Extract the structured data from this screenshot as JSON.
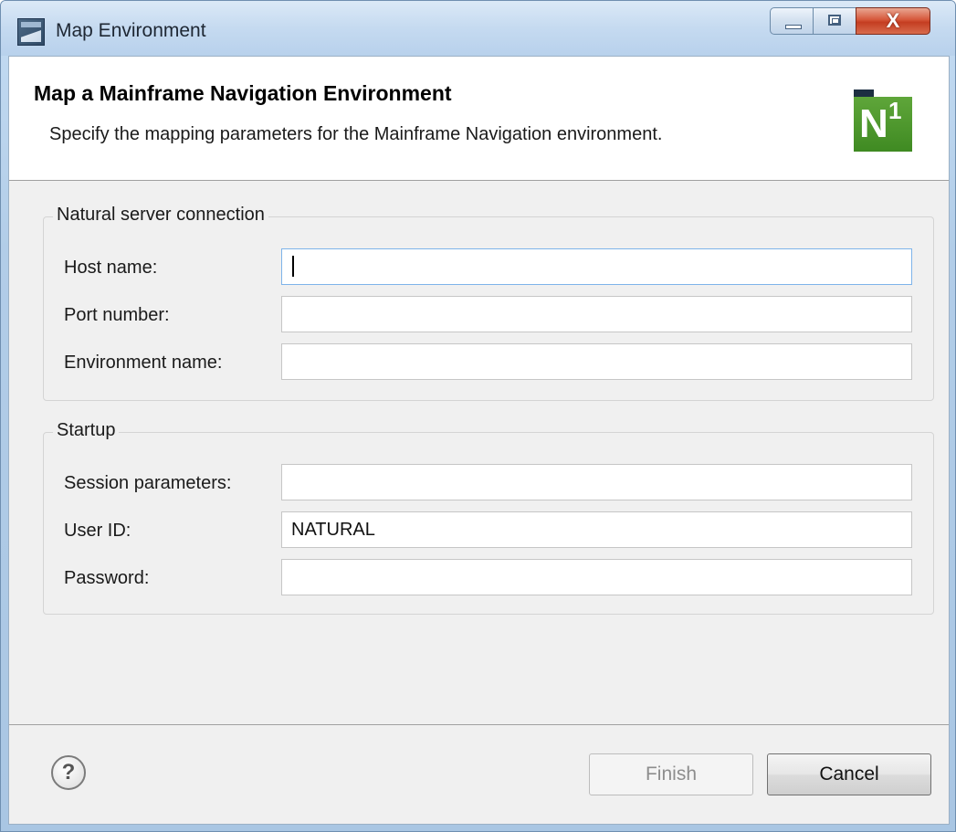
{
  "window": {
    "title": "Map Environment",
    "icons": {
      "app": "app-window-icon",
      "minimize": "minimize-icon",
      "maximize": "maximize-icon",
      "close": "close-icon"
    },
    "close_glyph": "X"
  },
  "header": {
    "title": "Map a Mainframe Navigation Environment",
    "description": "Specify the mapping parameters for the Mainframe Navigation environment.",
    "logo": {
      "letter": "N",
      "superscript": "1",
      "icon": "natural-one-logo-icon"
    }
  },
  "connection": {
    "title": "Natural server connection",
    "fields": [
      {
        "label": "Host name:",
        "value": "",
        "focused": true
      },
      {
        "label": "Port number:",
        "value": ""
      },
      {
        "label": "Environment name:",
        "value": ""
      }
    ]
  },
  "startup": {
    "title": "Startup",
    "fields": [
      {
        "label": "Session parameters:",
        "value": ""
      },
      {
        "label": "User ID:",
        "value": "NATURAL"
      },
      {
        "label": "Password:",
        "value": ""
      }
    ]
  },
  "footer": {
    "help_glyph": "?",
    "help_icon": "help-icon",
    "finish_label": "Finish",
    "finish_enabled": false,
    "cancel_label": "Cancel"
  },
  "colors": {
    "accent_focus": "#7eb4ea",
    "logo_green": "#4a9a2b",
    "close_red": "#c43d21"
  }
}
